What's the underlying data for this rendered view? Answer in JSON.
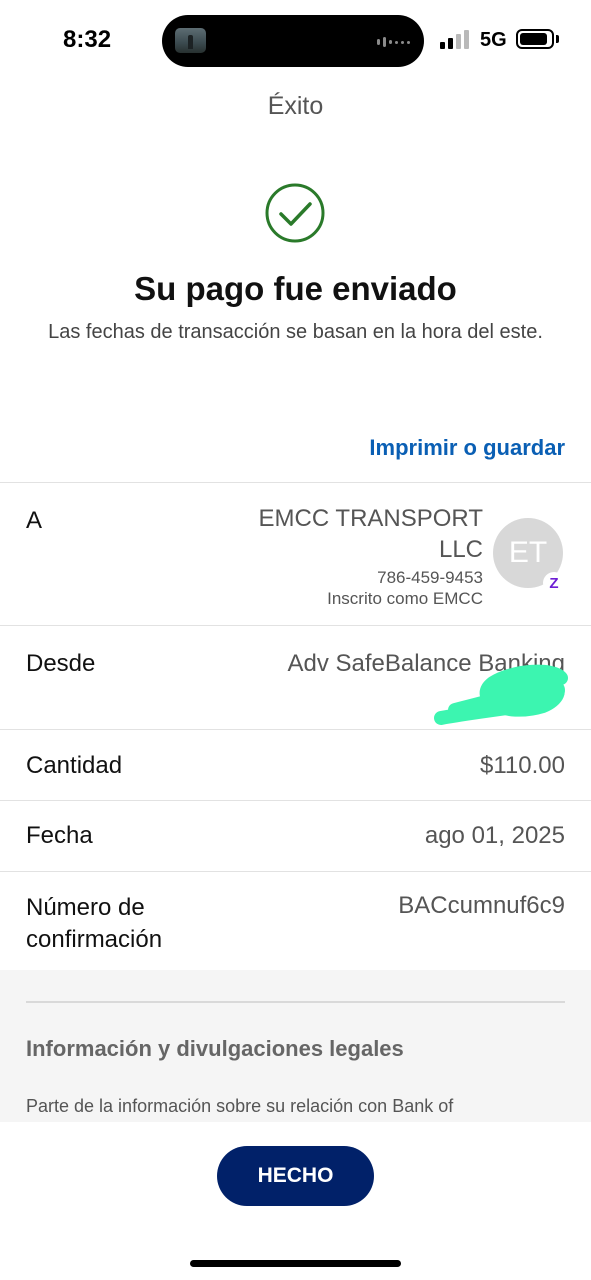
{
  "status_bar": {
    "time": "8:32",
    "network": "5G",
    "icons": [
      "island-thumbnail-icon",
      "audio-wave-icon",
      "signal-icon",
      "battery-icon"
    ]
  },
  "nav": {
    "title": "Éxito"
  },
  "confirmation": {
    "icon": "check-circle-icon",
    "icon_color": "#2a7a2a",
    "headline": "Su pago fue enviado",
    "subtitle": "Las fechas de transacción se basan en la hora del este."
  },
  "actions": {
    "print_label": "Imprimir o guardar"
  },
  "details": {
    "to": {
      "label": "A",
      "name": "EMCC TRANSPORT LLC",
      "phone": "786-459-9453",
      "enrolled": "Inscrito como EMCC",
      "avatar_initials": "ET",
      "badge": "Z"
    },
    "from": {
      "label": "Desde",
      "value": "Adv SafeBalance Banking"
    },
    "amount": {
      "label": "Cantidad",
      "value": "$110.00"
    },
    "date": {
      "label": "Fecha",
      "value": "ago 01, 2025"
    },
    "confirmation_number": {
      "label": "Número de confirmación",
      "value": "BACcumnuf6c9"
    }
  },
  "legal": {
    "title": "Información y divulgaciones legales",
    "text": "Parte de la información sobre su relación con Bank of"
  },
  "footer": {
    "done_label": "HECHO"
  },
  "colors": {
    "accent_link": "#0a5fb4",
    "primary_button": "#012169",
    "redaction": "#3cf5b0"
  }
}
